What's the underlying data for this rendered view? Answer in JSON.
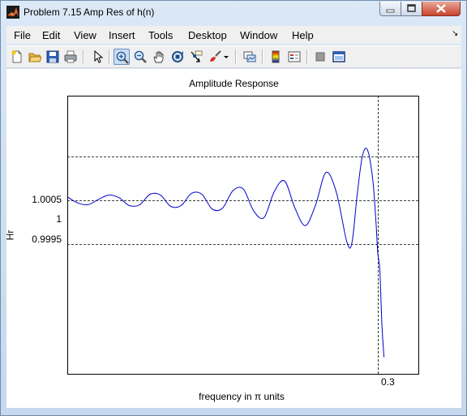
{
  "window": {
    "title": "Problem 7.15 Amp Res of h(n)"
  },
  "menu": [
    "File",
    "Edit",
    "View",
    "Insert",
    "Tools",
    "Desktop",
    "Window",
    "Help"
  ],
  "toolbar_icons": [
    "new-figure-icon",
    "open-file-icon",
    "save-icon",
    "print-icon",
    "edit-plot-arrow-icon",
    "zoom-in-icon",
    "zoom-out-icon",
    "pan-hand-icon",
    "rotate-3d-icon",
    "data-cursor-icon",
    "brush-icon",
    "brush-dropdown-icon",
    "link-plot-icon",
    "insert-colorbar-icon",
    "insert-legend-icon",
    "hide-plot-tools-icon",
    "show-plot-tools-icon"
  ],
  "colors": {
    "line": "#0000cc",
    "gridline": "#000000"
  },
  "chart_data": {
    "type": "line",
    "title": "Amplitude Response",
    "xlabel": "frequency in π units",
    "ylabel": "Hr",
    "xlim": [
      0,
      0.34
    ],
    "ylim": [
      0.998,
      1.0012
    ],
    "yticks": [
      0.9995,
      1,
      1.0005
    ],
    "ytick_labels": [
      "0.9995",
      "1",
      "1.0005"
    ],
    "xticks": [
      0.3
    ],
    "xtick_labels": [
      "0.3"
    ],
    "grid": "dashed lines at tick positions",
    "series": [
      {
        "x": [
          0,
          0.01,
          0.02,
          0.03,
          0.04,
          0.05,
          0.06,
          0.07,
          0.08,
          0.09,
          0.1,
          0.11,
          0.12,
          0.13,
          0.14,
          0.15,
          0.16,
          0.17,
          0.18,
          0.19,
          0.2,
          0.21,
          0.22,
          0.23,
          0.24,
          0.25,
          0.26,
          0.27,
          0.275,
          0.28,
          0.285,
          0.29,
          0.295,
          0.298,
          0.3,
          0.302,
          0.304,
          0.306
        ],
        "y": [
          1.00004,
          0.99997,
          0.99995,
          1.00001,
          1.00006,
          1.00003,
          0.99994,
          0.99995,
          1.00007,
          1.00006,
          0.99993,
          0.99994,
          1.00008,
          1.00007,
          0.9999,
          0.99991,
          1.00011,
          1.00013,
          0.99988,
          0.9998,
          1.0001,
          1.00022,
          0.99991,
          0.99971,
          0.99995,
          1.00032,
          1.00009,
          0.99953,
          0.99951,
          1.00005,
          1.0005,
          1.00058,
          1.00025,
          0.9998,
          0.9994,
          0.9992,
          0.99858,
          0.9982
        ]
      }
    ]
  }
}
